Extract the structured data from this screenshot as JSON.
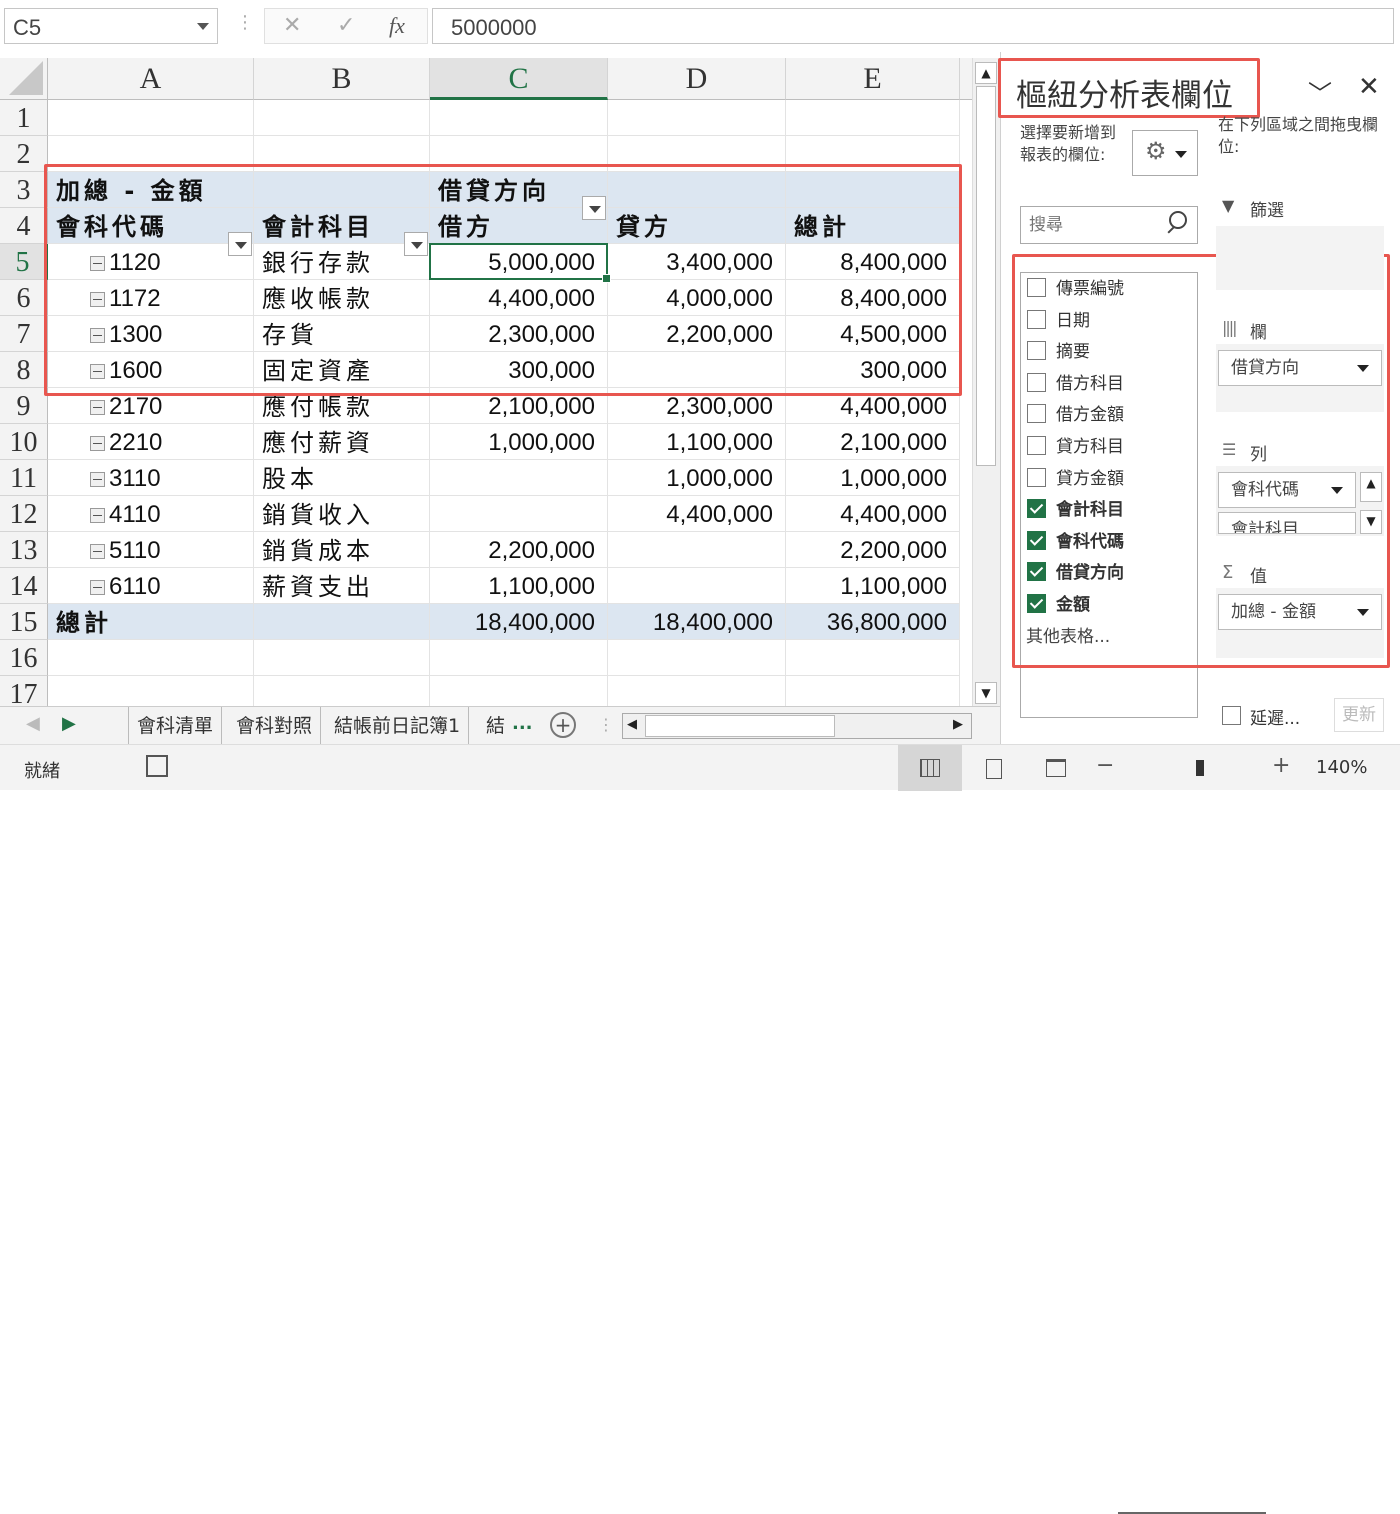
{
  "formula_bar": {
    "name_box": "C5",
    "cancel_icon": "✕",
    "enter_icon": "✓",
    "fx": "fx",
    "value": "5000000"
  },
  "columns": [
    "A",
    "B",
    "C",
    "D",
    "E"
  ],
  "rows": [
    "1",
    "2",
    "3",
    "4",
    "5",
    "6",
    "7",
    "8",
    "9",
    "10",
    "11",
    "12",
    "13",
    "14",
    "15",
    "16",
    "17"
  ],
  "pivot": {
    "sum_label": "加總 - 金額",
    "col_field": "借貸方向",
    "row_field1": "會科代碼",
    "row_field2": "會計科目",
    "col_headers": [
      "借方",
      "貸方",
      "總計"
    ],
    "data": [
      {
        "code": "1120",
        "name": "銀行存款",
        "debit": "5,000,000",
        "credit": "3,400,000",
        "total": "8,400,000"
      },
      {
        "code": "1172",
        "name": "應收帳款",
        "debit": "4,400,000",
        "credit": "4,000,000",
        "total": "8,400,000"
      },
      {
        "code": "1300",
        "name": "存貨",
        "debit": "2,300,000",
        "credit": "2,200,000",
        "total": "4,500,000"
      },
      {
        "code": "1600",
        "name": "固定資產",
        "debit": "300,000",
        "credit": "",
        "total": "300,000"
      },
      {
        "code": "2170",
        "name": "應付帳款",
        "debit": "2,100,000",
        "credit": "2,300,000",
        "total": "4,400,000"
      },
      {
        "code": "2210",
        "name": "應付薪資",
        "debit": "1,000,000",
        "credit": "1,100,000",
        "total": "2,100,000"
      },
      {
        "code": "3110",
        "name": "股本",
        "debit": "",
        "credit": "1,000,000",
        "total": "1,000,000"
      },
      {
        "code": "4110",
        "name": "銷貨收入",
        "debit": "",
        "credit": "4,400,000",
        "total": "4,400,000"
      },
      {
        "code": "5110",
        "name": "銷貨成本",
        "debit": "2,200,000",
        "credit": "",
        "total": "2,200,000"
      },
      {
        "code": "6110",
        "name": "薪資支出",
        "debit": "1,100,000",
        "credit": "",
        "total": "1,100,000"
      }
    ],
    "grand_total_label": "總計",
    "grand_total": {
      "debit": "18,400,000",
      "credit": "18,400,000",
      "total": "36,800,000"
    }
  },
  "sheet_tabs": [
    "會科清單",
    "會科對照",
    "結帳前日記簿1",
    "結"
  ],
  "more_tabs": "...",
  "status": {
    "ready": "就緒",
    "zoom": "140%"
  },
  "pane": {
    "title": "樞紐分析表欄位",
    "choose_fields": "選擇要新增到報表的欄位:",
    "drag_areas": "在下列區域之間拖曳欄位:",
    "search_placeholder": "搜尋",
    "fields": [
      {
        "label": "傳票編號",
        "checked": false
      },
      {
        "label": "日期",
        "checked": false
      },
      {
        "label": "摘要",
        "checked": false
      },
      {
        "label": "借方科目",
        "checked": false
      },
      {
        "label": "借方金額",
        "checked": false
      },
      {
        "label": "貸方科目",
        "checked": false
      },
      {
        "label": "貸方金額",
        "checked": false
      },
      {
        "label": "會計科目",
        "checked": true
      },
      {
        "label": "會科代碼",
        "checked": true
      },
      {
        "label": "借貸方向",
        "checked": true
      },
      {
        "label": "金額",
        "checked": true
      }
    ],
    "more_tables": "其他表格...",
    "filters_label": "篩選",
    "columns_label": "欄",
    "columns_value": "借貸方向",
    "rows_label": "列",
    "rows_values": [
      "會科代碼",
      "會計科目"
    ],
    "values_label": "值",
    "values_value": "加總 - 金額",
    "defer_label": "延遲...",
    "update_label": "更新"
  },
  "colors": {
    "accent": "#217346",
    "highlight_box": "#e8564f",
    "pivot_header": "#dce6f1"
  }
}
